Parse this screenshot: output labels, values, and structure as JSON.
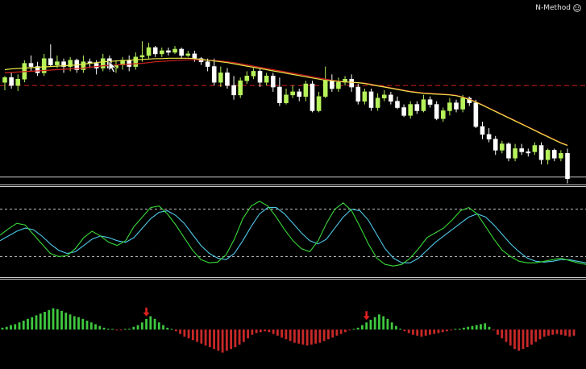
{
  "indicator": {
    "name": "N-Method",
    "icon": "smiley-icon"
  },
  "colors": {
    "background": "#000000",
    "candle_up": "#b6f25a",
    "candle_down": "#ffffff",
    "ma_fast": "#e8e64a",
    "ma_slow": "#d42020",
    "level_line": "#d42020",
    "bottom_line": "#c8c8c8",
    "stoch_main": "#38d838",
    "stoch_signal": "#4ec8e8",
    "stoch_levels": "#c8c8c8",
    "hist_positive": "#3ec83e",
    "hist_negative": "#c82828",
    "arrow": "#e02020",
    "separator": "#c8c8c8"
  },
  "price_chart": {
    "ohlc": [
      [
        92,
        86,
        102,
        84
      ],
      [
        86,
        96,
        100,
        80
      ],
      [
        96,
        88,
        103,
        82
      ],
      [
        88,
        68,
        92,
        64
      ],
      [
        68,
        72,
        78,
        58
      ],
      [
        72,
        80,
        84,
        66
      ],
      [
        80,
        62,
        84,
        56
      ],
      [
        62,
        70,
        72,
        44
      ],
      [
        70,
        66,
        74,
        58
      ],
      [
        66,
        72,
        80,
        62
      ],
      [
        72,
        64,
        78,
        60
      ],
      [
        64,
        76,
        80,
        62
      ],
      [
        76,
        66,
        80,
        58
      ],
      [
        66,
        68,
        74,
        62
      ],
      [
        68,
        74,
        82,
        64
      ],
      [
        74,
        62,
        78,
        56
      ],
      [
        62,
        74,
        78,
        58
      ],
      [
        74,
        70,
        80,
        64
      ],
      [
        70,
        64,
        76,
        60
      ],
      [
        64,
        72,
        78,
        58
      ],
      [
        72,
        60,
        76,
        54
      ],
      [
        60,
        58,
        66,
        40
      ],
      [
        58,
        48,
        62,
        42
      ],
      [
        48,
        56,
        60,
        46
      ],
      [
        56,
        52,
        60,
        48
      ],
      [
        52,
        54,
        58,
        48
      ],
      [
        54,
        50,
        56,
        46
      ],
      [
        50,
        58,
        62,
        48
      ],
      [
        58,
        56,
        60,
        52
      ],
      [
        56,
        62,
        66,
        52
      ],
      [
        62,
        66,
        70,
        60
      ],
      [
        66,
        72,
        78,
        62
      ],
      [
        72,
        92,
        96,
        62
      ],
      [
        92,
        80,
        98,
        72
      ],
      [
        80,
        96,
        100,
        74
      ],
      [
        96,
        108,
        114,
        84
      ],
      [
        108,
        90,
        112,
        86
      ],
      [
        90,
        84,
        94,
        78
      ],
      [
        84,
        78,
        88,
        74
      ],
      [
        78,
        92,
        98,
        74
      ],
      [
        92,
        84,
        96,
        80
      ],
      [
        84,
        98,
        104,
        80
      ],
      [
        98,
        118,
        122,
        86
      ],
      [
        118,
        108,
        120,
        100
      ],
      [
        108,
        104,
        112,
        96
      ],
      [
        104,
        110,
        116,
        100
      ],
      [
        110,
        94,
        116,
        90
      ],
      [
        94,
        128,
        130,
        90
      ],
      [
        128,
        110,
        130,
        104
      ],
      [
        110,
        90,
        112,
        72
      ],
      [
        90,
        100,
        104,
        82
      ],
      [
        100,
        92,
        104,
        86
      ],
      [
        92,
        88,
        96,
        84
      ],
      [
        88,
        98,
        104,
        82
      ],
      [
        98,
        116,
        120,
        94
      ],
      [
        116,
        104,
        120,
        100
      ],
      [
        104,
        124,
        128,
        100
      ],
      [
        124,
        112,
        128,
        106
      ],
      [
        112,
        108,
        116,
        102
      ],
      [
        108,
        116,
        120,
        104
      ],
      [
        116,
        124,
        126,
        110
      ],
      [
        124,
        134,
        136,
        120
      ],
      [
        134,
        120,
        138,
        116
      ],
      [
        120,
        128,
        132,
        116
      ],
      [
        128,
        114,
        130,
        108
      ],
      [
        114,
        120,
        124,
        110
      ],
      [
        120,
        138,
        140,
        116
      ],
      [
        138,
        128,
        142,
        124
      ],
      [
        128,
        118,
        134,
        112
      ],
      [
        118,
        126,
        130,
        114
      ],
      [
        126,
        112,
        130,
        108
      ],
      [
        112,
        118,
        122,
        110
      ],
      [
        118,
        148,
        150,
        114
      ],
      [
        148,
        158,
        164,
        142
      ],
      [
        158,
        164,
        168,
        150
      ],
      [
        164,
        178,
        184,
        160
      ],
      [
        178,
        170,
        182,
        166
      ],
      [
        170,
        188,
        192,
        168
      ],
      [
        188,
        176,
        192,
        170
      ],
      [
        176,
        180,
        184,
        170
      ],
      [
        180,
        180,
        186,
        176
      ],
      [
        180,
        172,
        184,
        168
      ],
      [
        172,
        190,
        196,
        168
      ],
      [
        190,
        178,
        196,
        176
      ],
      [
        178,
        188,
        192,
        176
      ],
      [
        188,
        182,
        192,
        178
      ],
      [
        182,
        214,
        220,
        176
      ]
    ],
    "ma_fast": [
      76,
      75,
      74.5,
      74,
      73.5,
      73,
      72.5,
      72,
      71.5,
      71,
      70.5,
      70,
      69,
      68,
      67,
      66,
      65.5,
      65,
      64.5,
      64,
      63.5,
      63,
      62.5,
      62,
      62,
      61.5,
      61.5,
      61.5,
      61.5,
      62,
      63,
      64,
      65,
      66,
      67,
      68.5,
      70,
      71.5,
      73,
      74.5,
      76,
      77.5,
      79,
      80.5,
      82,
      83.5,
      85,
      86.5,
      88,
      89.5,
      90,
      91,
      91.5,
      92,
      92.5,
      93.5,
      95,
      96.5,
      98,
      99.5,
      101,
      102.5,
      104,
      105,
      106,
      106.5,
      107,
      107.5,
      108,
      109,
      111,
      114,
      117,
      121,
      125,
      129,
      133,
      137,
      141,
      145,
      149,
      153,
      157,
      161,
      165,
      169,
      172
    ],
    "ma_slow": [
      80,
      79.5,
      79,
      78.5,
      78,
      77.5,
      77,
      76.5,
      76,
      75.5,
      75,
      74.5,
      74,
      73,
      72,
      71,
      70.5,
      70,
      69.5,
      69,
      68.5,
      68,
      67,
      66,
      65.5,
      65,
      64.5,
      64,
      63.5,
      63.5,
      63.5,
      64,
      64.5,
      65,
      66,
      67,
      68.5,
      70,
      71.5,
      73,
      74.5,
      76,
      77.5,
      79,
      80.5,
      82,
      83.5,
      85,
      86.5,
      88,
      89.5,
      90.5,
      91.5,
      92,
      92.5,
      93,
      94.5,
      96,
      97.5,
      99,
      100.5,
      102,
      103.5,
      104.5,
      105.5,
      106,
      106.5,
      107,
      107.5,
      108.5,
      110.5,
      113.5,
      116.5,
      120.5,
      124.5,
      128.5,
      132.5,
      136.5,
      140.5,
      144.5,
      148.5,
      152.5,
      156.5,
      160.5,
      164.5,
      168.5,
      171.5
    ],
    "level_lines": [
      96,
      212
    ]
  },
  "stochastic": {
    "main": [
      47,
      55,
      62,
      60,
      48,
      36,
      24,
      20,
      21,
      30,
      44,
      52,
      46,
      38,
      34,
      40,
      58,
      70,
      82,
      84,
      74,
      60,
      44,
      28,
      16,
      12,
      13,
      22,
      42,
      68,
      84,
      90,
      84,
      70,
      54,
      40,
      30,
      26,
      40,
      62,
      80,
      88,
      78,
      58,
      36,
      18,
      10,
      8,
      10,
      18,
      30,
      44,
      50,
      56,
      66,
      78,
      82,
      74,
      58,
      42,
      28,
      20,
      14,
      12,
      12,
      14,
      16,
      18,
      15,
      12,
      10
    ],
    "signal": [
      40,
      46,
      52,
      56,
      54,
      46,
      36,
      28,
      24,
      26,
      34,
      42,
      46,
      44,
      40,
      38,
      44,
      56,
      68,
      76,
      78,
      72,
      62,
      48,
      34,
      24,
      18,
      16,
      24,
      40,
      58,
      74,
      82,
      82,
      74,
      62,
      50,
      40,
      36,
      42,
      56,
      70,
      80,
      78,
      66,
      48,
      30,
      18,
      12,
      12,
      18,
      28,
      38,
      46,
      54,
      62,
      70,
      74,
      70,
      60,
      48,
      36,
      26,
      18,
      14,
      13,
      14,
      16,
      16,
      14,
      12
    ],
    "levels": [
      80,
      20
    ]
  },
  "histogram": {
    "values": [
      2,
      3,
      5,
      6,
      8,
      10,
      12,
      14,
      16,
      18,
      20,
      22,
      24,
      23,
      21,
      19,
      17,
      15,
      14,
      12,
      10,
      8,
      6,
      4,
      2,
      1,
      0,
      -1,
      -1,
      0,
      1,
      3,
      5,
      8,
      12,
      15,
      12,
      8,
      5,
      2,
      0,
      -2,
      -5,
      -8,
      -10,
      -12,
      -14,
      -16,
      -18,
      -20,
      -22,
      -24,
      -26,
      -24,
      -22,
      -20,
      -17,
      -14,
      -10,
      -6,
      -4,
      -3,
      -2,
      -3,
      -5,
      -7,
      -9,
      -11,
      -13,
      -15,
      -16,
      -17,
      -18,
      -17,
      -16,
      -15,
      -13,
      -11,
      -9,
      -7,
      -5,
      -3,
      -1,
      0,
      2,
      5,
      8,
      11,
      14,
      17,
      15,
      12,
      8,
      4,
      1,
      -2,
      -4,
      -6,
      -7,
      -8,
      -7,
      -6,
      -5,
      -4,
      -3,
      -2,
      -1,
      0,
      1,
      2,
      3,
      4,
      5,
      6,
      7,
      3,
      -1,
      -6,
      -10,
      -14,
      -18,
      -22,
      -24,
      -22,
      -20,
      -17,
      -14,
      -11,
      -8,
      -7,
      -6,
      -5,
      -6,
      -7,
      -8,
      -7
    ],
    "arrows": [
      {
        "bar": 34,
        "color": "#e02020"
      },
      {
        "bar": 86,
        "color": "#e02020"
      }
    ]
  }
}
